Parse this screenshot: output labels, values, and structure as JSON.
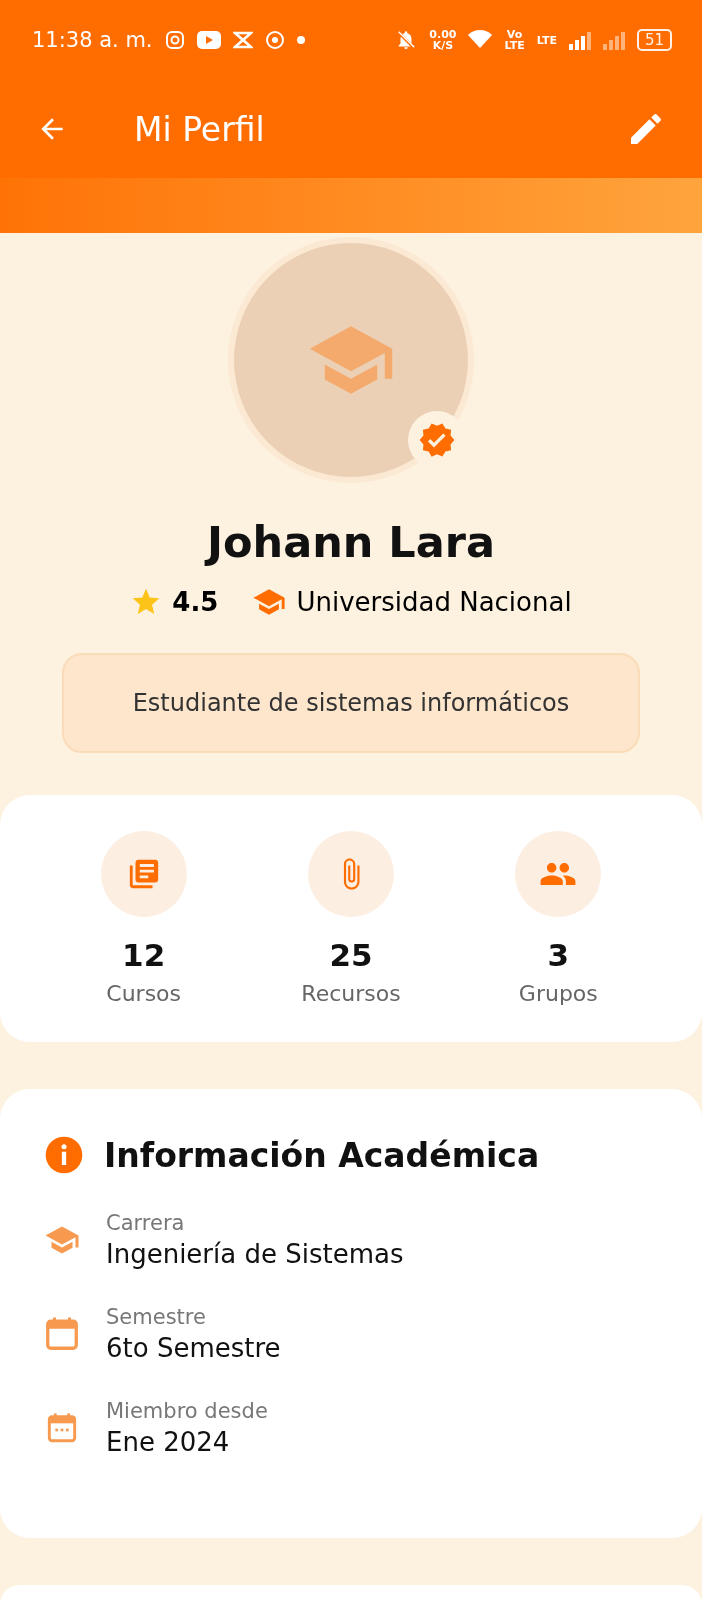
{
  "status_bar": {
    "time": "11:38 a. m.",
    "net_speed": "0.00",
    "net_unit": "K/S",
    "volte_top": "Vo",
    "volte_bottom": "LTE",
    "lte": "LTE",
    "battery": "51"
  },
  "app_bar": {
    "title": "Mi Perfil"
  },
  "profile": {
    "name": "Johann Lara",
    "verified": true,
    "rating": "4.5",
    "university": "Universidad Nacional",
    "bio": "Estudiante de sistemas informáticos"
  },
  "stats": [
    {
      "kind": "courses",
      "value": "12",
      "label": "Cursos"
    },
    {
      "kind": "resources",
      "value": "25",
      "label": "Recursos"
    },
    {
      "kind": "groups",
      "value": "3",
      "label": "Grupos"
    }
  ],
  "academic_info": {
    "title": "Información Académica",
    "items": [
      {
        "kind": "degree",
        "label": "Carrera",
        "value": "Ingeniería de Sistemas"
      },
      {
        "kind": "semester",
        "label": "Semestre",
        "value": "6to Semestre"
      },
      {
        "kind": "member",
        "label": "Miembro desde",
        "value": "Ene 2024"
      }
    ]
  }
}
